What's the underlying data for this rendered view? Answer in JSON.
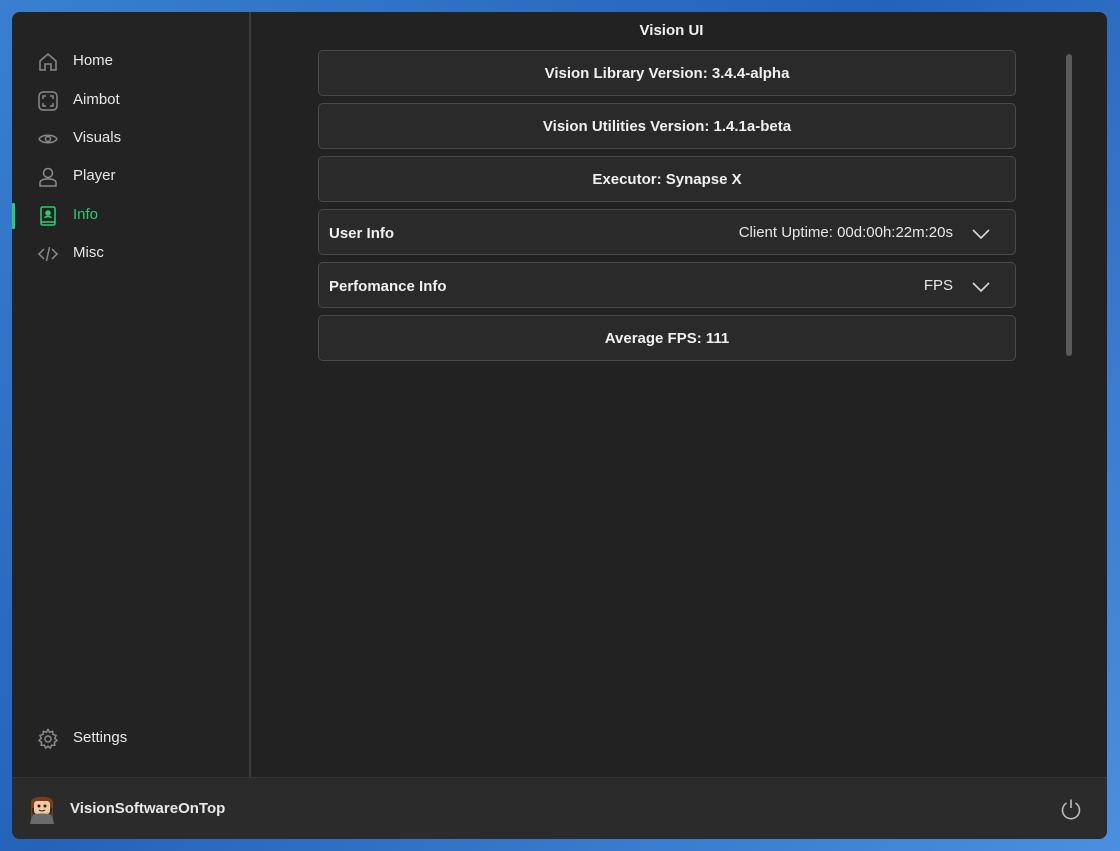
{
  "window": {
    "title": "Vision UI"
  },
  "sidebar": {
    "items": [
      {
        "label": "Home",
        "icon": "home-icon"
      },
      {
        "label": "Aimbot",
        "icon": "crosshair-frame-icon"
      },
      {
        "label": "Visuals",
        "icon": "eye-icon"
      },
      {
        "label": "Player",
        "icon": "user-icon"
      },
      {
        "label": "Info",
        "icon": "book-icon",
        "active": true
      },
      {
        "label": "Misc",
        "icon": "code-icon"
      }
    ],
    "settings_label": "Settings"
  },
  "main": {
    "cards": [
      {
        "text": "Vision Library Version: 3.4.4-alpha"
      },
      {
        "text": "Vision Utilities Version: 1.4.1a-beta"
      },
      {
        "text": "Executor: Synapse X"
      },
      {
        "label": "User Info",
        "value": "Client Uptime: 00d:00h:22m:20s"
      },
      {
        "label": "Perfomance Info",
        "value": "FPS"
      },
      {
        "text": "Average FPS: 111"
      }
    ]
  },
  "footer": {
    "username": "VisionSoftwareOnTop"
  },
  "colors": {
    "accent": "#2ecc71",
    "background": "#222222",
    "card": "#2a2a2a"
  }
}
